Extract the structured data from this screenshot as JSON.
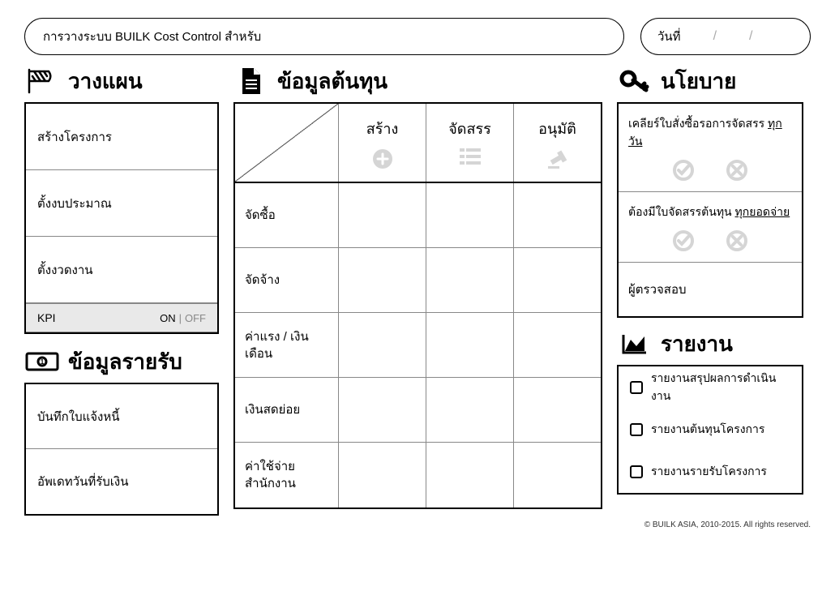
{
  "header": {
    "title": "การวางระบบ BUILK Cost Control สำหรับ",
    "date_label": "วันที่"
  },
  "sections": {
    "plan": {
      "title": "วางแผน"
    },
    "cost": {
      "title": "ข้อมูลต้นทุน"
    },
    "policy": {
      "title": "นโยบาย"
    },
    "receipts": {
      "title": "ข้อมูลรายรับ"
    },
    "reports": {
      "title": "รายงาน"
    }
  },
  "plan": {
    "items": [
      "สร้างโครงการ",
      "ตั้งงบประมาณ",
      "ตั้งงวดงาน"
    ],
    "kpi_label": "KPI",
    "kpi_on": "ON",
    "kpi_off": "OFF"
  },
  "receipts": {
    "items": [
      "บันทึกใบแจ้งหนี้",
      "อัพเดทวันที่รับเงิน"
    ]
  },
  "cost": {
    "columns": [
      "สร้าง",
      "จัดสรร",
      "อนุมัติ"
    ],
    "rows": [
      "จัดซื้อ",
      "จัดจ้าง",
      "ค่าแรง / เงินเดือน",
      "เงินสดย่อย",
      "ค่าใช้จ่ายสำนักงาน"
    ]
  },
  "policy": {
    "items": [
      {
        "text_pre": "เคลียร์ใบสั่งซื้อรอการจัดสรร ",
        "text_u": "ทุกวัน"
      },
      {
        "text_pre": "ต้องมีใบจัดสรรต้นทุน ",
        "text_u": "ทุกยอดจ่าย"
      }
    ],
    "inspector": "ผู้ตรวจสอบ"
  },
  "reports": {
    "items": [
      "รายงานสรุปผลการดำเนินงาน",
      "รายงานต้นทุนโครงการ",
      "รายงานรายรับโครงการ"
    ]
  },
  "footer": "© BUILK ASIA, 2010-2015. All rights reserved."
}
